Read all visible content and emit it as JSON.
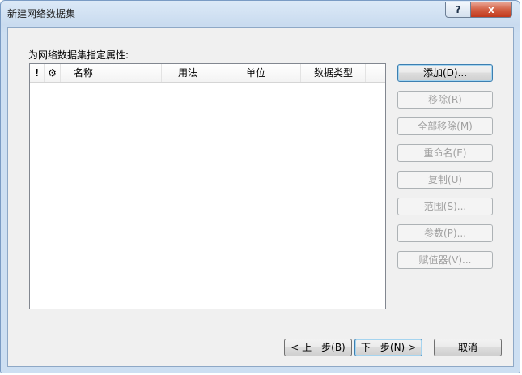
{
  "window": {
    "title": "新建网络数据集",
    "help_label": "?",
    "close_label": "x"
  },
  "prompt": "为网络数据集指定属性:",
  "table": {
    "columns": [
      {
        "key": "exclaim",
        "label": "!",
        "icon": "exclamation-icon"
      },
      {
        "key": "gear",
        "label": "⚙",
        "icon": "gear-icon"
      },
      {
        "key": "name",
        "label": "名称"
      },
      {
        "key": "usage",
        "label": "用法"
      },
      {
        "key": "unit",
        "label": "单位"
      },
      {
        "key": "datatype",
        "label": "数据类型"
      }
    ],
    "rows": []
  },
  "buttons": {
    "add": {
      "label": "添加(D)...",
      "enabled": true
    },
    "remove": {
      "label": "移除(R)",
      "enabled": false
    },
    "remove_all": {
      "label": "全部移除(M)",
      "enabled": false
    },
    "rename": {
      "label": "重命名(E)",
      "enabled": false
    },
    "copy": {
      "label": "复制(U)",
      "enabled": false
    },
    "range": {
      "label": "范围(S)...",
      "enabled": false
    },
    "params": {
      "label": "参数(P)...",
      "enabled": false
    },
    "evaluators": {
      "label": "赋值器(V)...",
      "enabled": false
    }
  },
  "nav": {
    "back": "< 上一步(B)",
    "next": "下一步(N) >",
    "cancel": "取消"
  }
}
